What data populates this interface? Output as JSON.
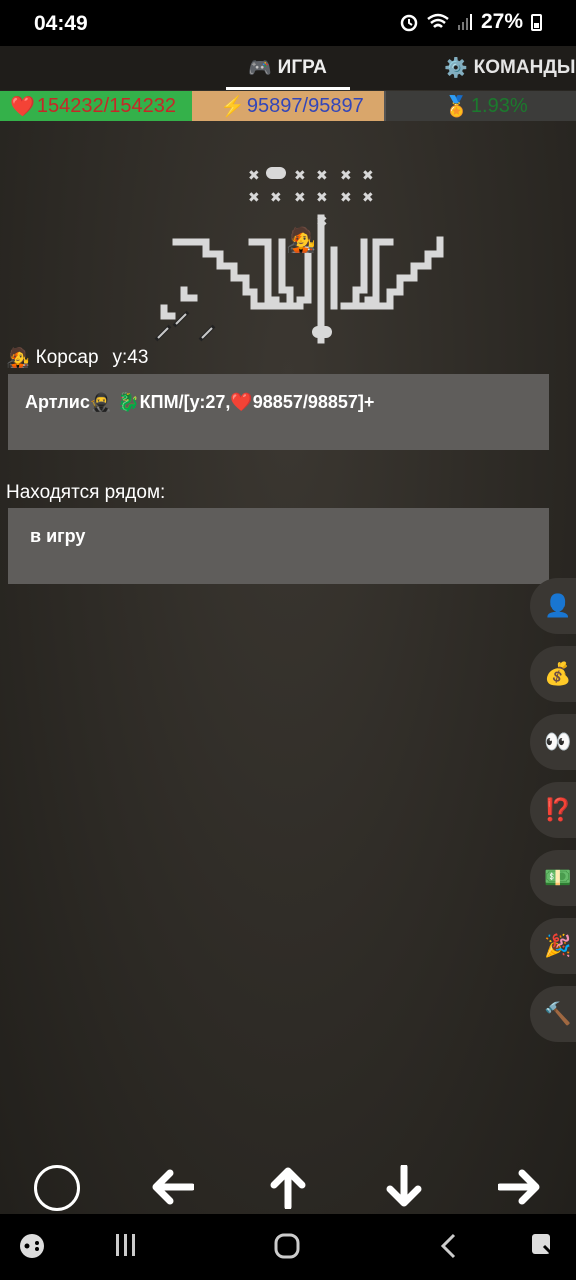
{
  "status_bar": {
    "time": "04:49",
    "battery": "27%"
  },
  "tabs": [
    {
      "label": "ИГРА",
      "icon": "gamepad-icon",
      "active": true
    },
    {
      "label": "КОМАНДЫ",
      "icon": "gear-icon",
      "active": false
    }
  ],
  "stats": {
    "hp": "154232/154232",
    "energy": "95897/95897",
    "xp": "1.93%"
  },
  "player": {
    "name": "Корсар",
    "level": "у:43"
  },
  "panel_top": {
    "text": "Артлис🥷 🐉КПМ/[у:27,❤️98857/98857]+"
  },
  "nearby": {
    "label": "Находятся рядом:",
    "text": "в игру"
  },
  "side_buttons": [
    {
      "icon": "person-icon",
      "glyph": "👤"
    },
    {
      "icon": "money-bag-icon",
      "glyph": "💰"
    },
    {
      "icon": "eyes-icon",
      "glyph": "👀"
    },
    {
      "icon": "exclamation-question-icon",
      "glyph": "⁉️"
    },
    {
      "icon": "banknote-icon",
      "glyph": "💵"
    },
    {
      "icon": "party-popper-icon",
      "glyph": "🎉"
    },
    {
      "icon": "hammer-icon",
      "glyph": "🔨"
    }
  ],
  "colors": {
    "hp_bg": "#34b14a",
    "energy_bg": "#d9a66b",
    "panel": "#5f5d5b"
  }
}
